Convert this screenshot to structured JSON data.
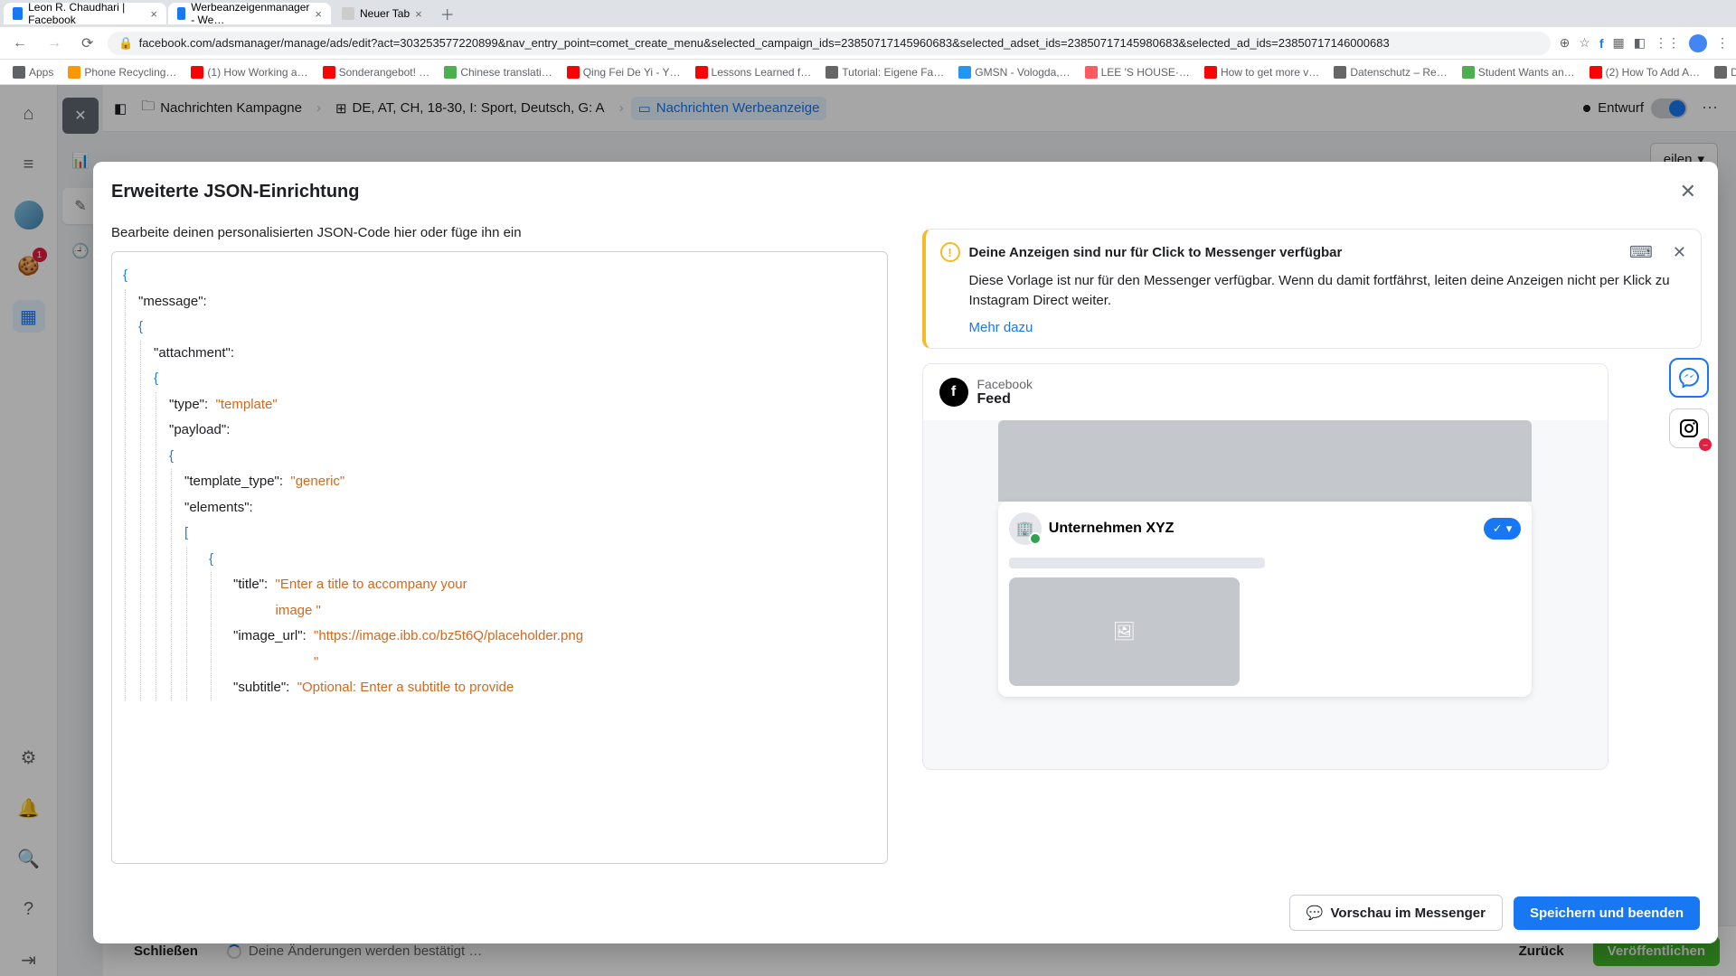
{
  "browser": {
    "tabs": [
      {
        "title": "Leon R. Chaudhari | Facebook"
      },
      {
        "title": "Werbeanzeigenmanager - We…"
      },
      {
        "title": "Neuer Tab"
      }
    ],
    "url": "facebook.com/adsmanager/manage/ads/edit?act=303253577220899&nav_entry_point=comet_create_menu&selected_campaign_ids=23850717145960683&selected_adset_ids=23850717145980683&selected_ad_ids=23850717146000683",
    "bookmarks": [
      "Apps",
      "Phone Recycling…",
      "(1) How Working a…",
      "Sonderangebot! …",
      "Chinese translati…",
      "Qing Fei De Yi - Y…",
      "Lessons Learned f…",
      "Tutorial: Eigene Fa…",
      "GMSN - Vologda,…",
      "LEE 'S HOUSE·…",
      "How to get more v…",
      "Datenschutz – Re…",
      "Student Wants an…",
      "(2) How To Add A…",
      "Download - Cooki…"
    ]
  },
  "header": {
    "campaign": "Nachrichten Kampagne",
    "adset": "DE, AT, CH, 18-30, I: Sport, Deutsch, G: A",
    "ad": "Nachrichten Werbeanzeige",
    "status": "Entwurf",
    "share": "eilen"
  },
  "modal": {
    "title": "Erweiterte JSON-Einrichtung",
    "editorLabel": "Bearbeite deinen personalisierten JSON-Code hier oder füge ihn ein",
    "json": {
      "k_message": "\"message\":",
      "k_attachment": "\"attachment\":",
      "k_type": "\"type\":",
      "v_type": "\"template\"",
      "k_payload": "\"payload\":",
      "k_template_type": "\"template_type\":",
      "v_template_type": "\"generic\"",
      "k_elements": "\"elements\":",
      "k_title": "\"title\":",
      "v_title": "\"Enter a title to accompany your image                               \"",
      "k_image_url": "\"image_url\":",
      "v_image_url": "\"https://image.ibb.co/bz5t6Q/placeholder.png                               \"",
      "k_subtitle": "\"subtitle\":",
      "v_subtitle": "\"Optional: Enter a subtitle to provide"
    },
    "warning": {
      "title": "Deine Anzeigen sind nur für Click to Messenger verfügbar",
      "body": "Diese Vorlage ist nur für den Messenger verfügbar. Wenn du damit fortfährst, leiten deine Anzeigen nicht per Klick zu Instagram Direct weiter.",
      "link": "Mehr dazu"
    },
    "preview": {
      "platform": "Facebook",
      "surface": "Feed",
      "business": "Unternehmen XYZ"
    },
    "footer": {
      "preview": "Vorschau im Messenger",
      "save": "Speichern und beenden"
    }
  },
  "bottom": {
    "close": "Schließen",
    "status": "Deine Änderungen werden bestätigt …",
    "back": "Zurück",
    "publish": "Veröffentlichen"
  },
  "leftbar": {
    "badge": "1"
  }
}
